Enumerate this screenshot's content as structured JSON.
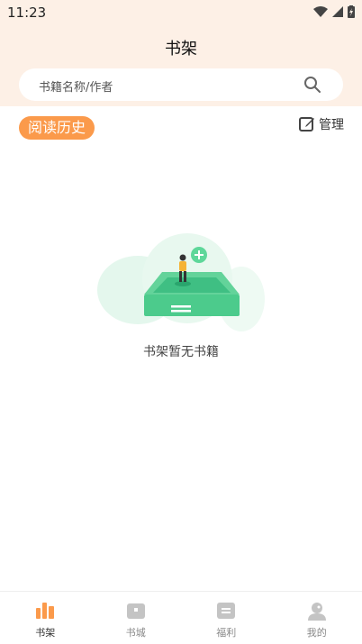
{
  "status_bar": {
    "time": "11:23"
  },
  "header": {
    "title": "书架"
  },
  "search": {
    "placeholder": "书籍名称/作者"
  },
  "section": {
    "label": "阅读历史",
    "manage_label": "管理"
  },
  "empty_state": {
    "message": "书架暂无书籍"
  },
  "tabs": [
    {
      "label": "书架",
      "icon": "bookshelf-icon",
      "active": true
    },
    {
      "label": "书城",
      "icon": "bookstore-icon",
      "active": false
    },
    {
      "label": "福利",
      "icon": "welfare-icon",
      "active": false
    },
    {
      "label": "我的",
      "icon": "profile-icon",
      "active": false
    }
  ],
  "colors": {
    "accent": "#fb9a4b",
    "header_bg": "#fdf0e6",
    "illustration_green": "#43c987"
  }
}
